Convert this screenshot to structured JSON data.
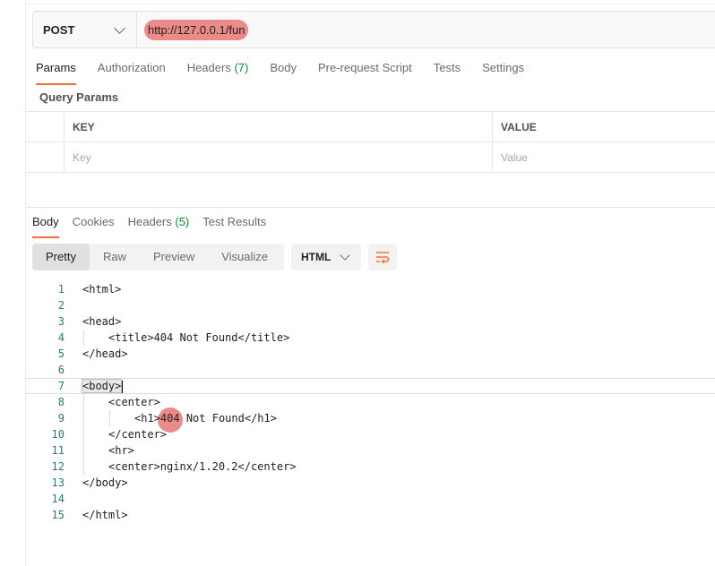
{
  "request": {
    "method": "POST",
    "url": "http://127.0.0.1/fun"
  },
  "request_tabs": [
    {
      "label": "Params",
      "active": true
    },
    {
      "label": "Authorization"
    },
    {
      "label": "Headers",
      "count": "(7)"
    },
    {
      "label": "Body"
    },
    {
      "label": "Pre-request Script"
    },
    {
      "label": "Tests"
    },
    {
      "label": "Settings"
    }
  ],
  "query_params": {
    "title": "Query Params",
    "key_header": "KEY",
    "value_header": "VALUE",
    "key_placeholder": "Key",
    "value_placeholder": "Value"
  },
  "response_tabs": [
    {
      "label": "Body",
      "active": true
    },
    {
      "label": "Cookies"
    },
    {
      "label": "Headers",
      "count": "(5)"
    },
    {
      "label": "Test Results"
    }
  ],
  "view_modes": [
    "Pretty",
    "Raw",
    "Preview",
    "Visualize"
  ],
  "format": "HTML",
  "code_lines": [
    {
      "n": "1",
      "text": "<html>"
    },
    {
      "n": "2",
      "text": ""
    },
    {
      "n": "3",
      "text": "<head>"
    },
    {
      "n": "4",
      "text": "<title>404 Not Found</title>"
    },
    {
      "n": "5",
      "text": "</head>"
    },
    {
      "n": "6",
      "text": ""
    },
    {
      "n": "7",
      "text": "<body>"
    },
    {
      "n": "8",
      "text": "<center>"
    },
    {
      "n": "9a",
      "text": "<h1>"
    },
    {
      "n": "9b",
      "text": "404"
    },
    {
      "n": "9c",
      "text": " Not Found</h1>"
    },
    {
      "n": "10",
      "text": "</center>"
    },
    {
      "n": "11",
      "text": "<hr>"
    },
    {
      "n": "12",
      "text": "<center>nginx/1.20.2</center>"
    },
    {
      "n": "13",
      "text": "</body>"
    },
    {
      "n": "14",
      "text": ""
    },
    {
      "n": "15",
      "text": "</html>"
    }
  ],
  "line_numbers": [
    "1",
    "2",
    "3",
    "4",
    "5",
    "6",
    "7",
    "8",
    "9",
    "10",
    "11",
    "12",
    "13",
    "14",
    "15"
  ],
  "colors": {
    "accent": "#ff6c37",
    "highlight": "#ec8a88",
    "count_green": "#0b8a38",
    "line_number": "#2b7a78"
  }
}
